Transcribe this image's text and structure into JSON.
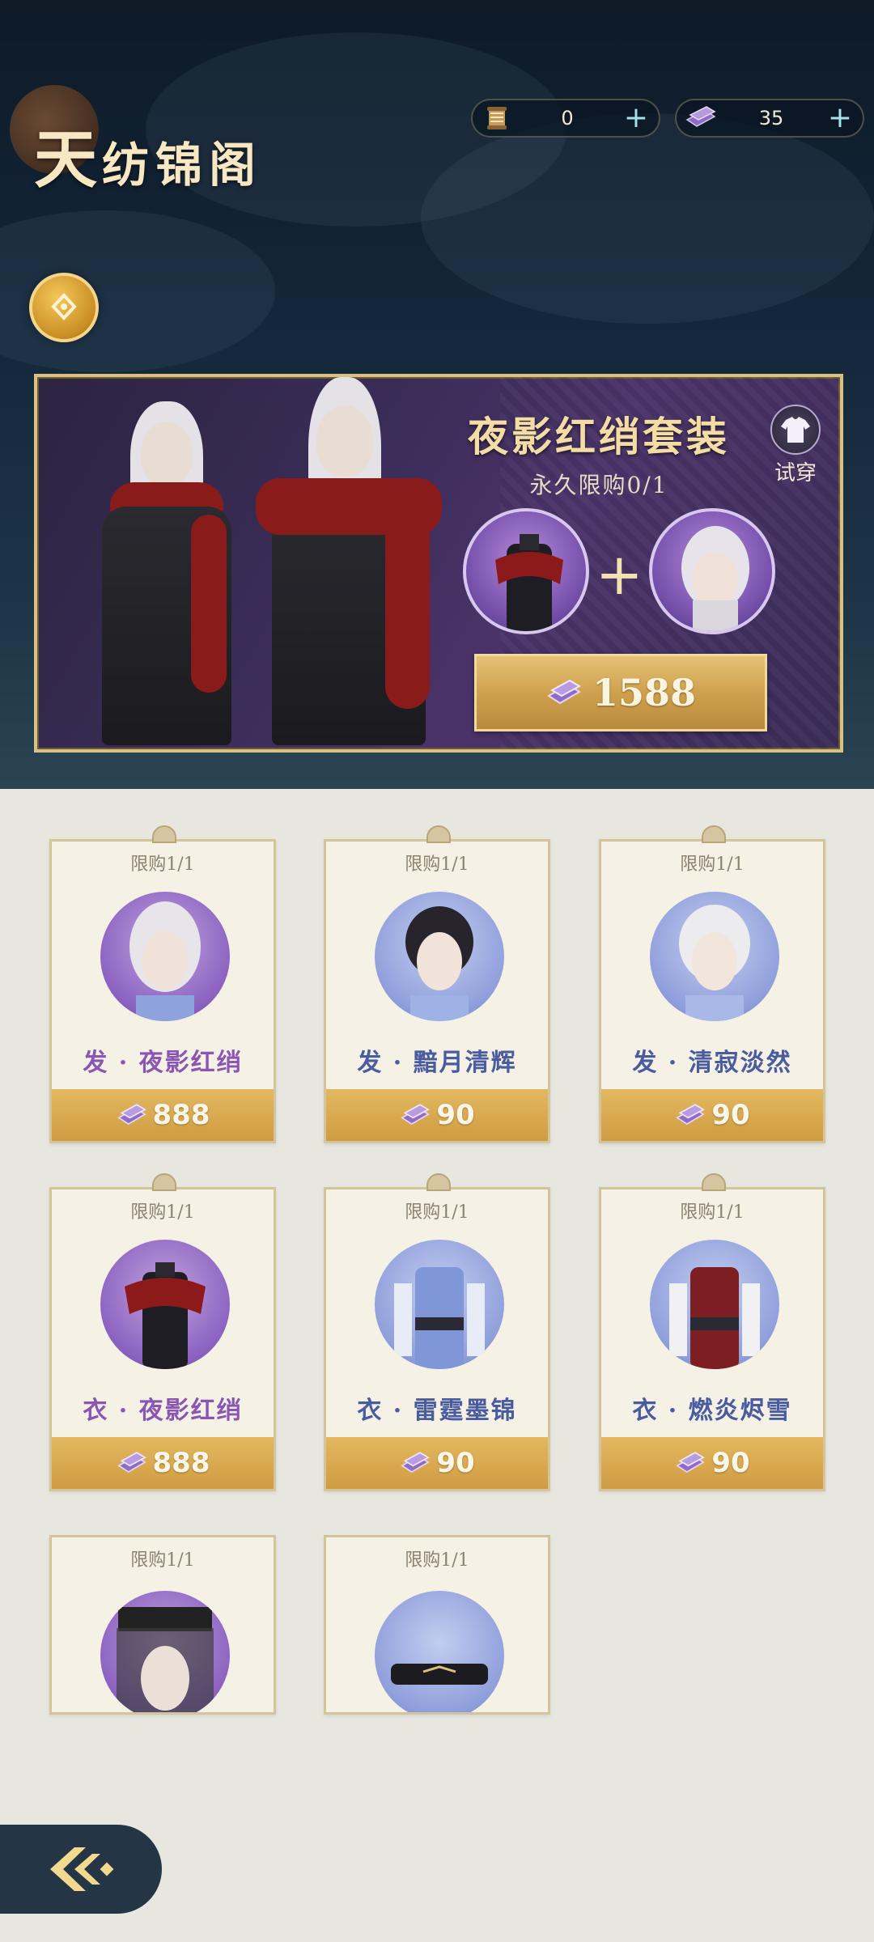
{
  "header": {
    "title_first": "天",
    "title_rest": "纺锦阁",
    "currency": [
      {
        "icon": "thread-spool-icon",
        "amount": "0",
        "add": "+"
      },
      {
        "icon": "fabric-ticket-icon",
        "amount": "35",
        "add": "+"
      }
    ]
  },
  "banner": {
    "set_title": "夜影红绡套装",
    "limit_text": "永久限购0/1",
    "try_on_label": "试穿",
    "plus": "+",
    "price": "1588"
  },
  "items": [
    {
      "limit": "限购1/1",
      "name": "发 · 夜影红绡",
      "price": "888"
    },
    {
      "limit": "限购1/1",
      "name": "发 · 黯月清辉",
      "price": "90"
    },
    {
      "limit": "限购1/1",
      "name": "发 · 清寂淡然",
      "price": "90"
    },
    {
      "limit": "限购1/1",
      "name": "衣 · 夜影红绡",
      "price": "888"
    },
    {
      "limit": "限购1/1",
      "name": "衣 · 雷霆墨锦",
      "price": "90"
    },
    {
      "limit": "限购1/1",
      "name": "衣 · 燃炎烬雪",
      "price": "90"
    },
    {
      "limit": "限购1/1"
    },
    {
      "limit": "限购1/1"
    }
  ]
}
